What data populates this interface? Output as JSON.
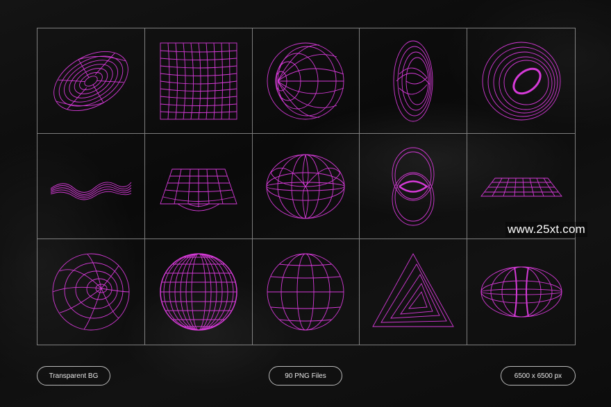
{
  "watermark": "www.25xt.com",
  "badges": [
    "Transparent BG",
    "90 PNG Files",
    "6500 x 6500 px"
  ],
  "colors": {
    "accent": "#d63ad8",
    "background": "#0b0b0b",
    "grid_lines": "#dcdcdc"
  },
  "shapes": [
    "wire-torus-tilted-icon",
    "wire-grid-square-icon",
    "wire-sphere-polar-icon",
    "wire-spiral-loop-icon",
    "wire-ring-vortex-icon",
    "wire-ribbon-wave-icon",
    "wire-funnel-plane-icon",
    "wire-apple-torus-icon",
    "wire-double-loop-icon",
    "wire-flat-plane-icon",
    "wire-sphere-pole-icon",
    "wire-dense-sphere-icon",
    "wire-globe-icon",
    "wire-triangle-spiral-icon",
    "wire-torus-front-icon"
  ]
}
